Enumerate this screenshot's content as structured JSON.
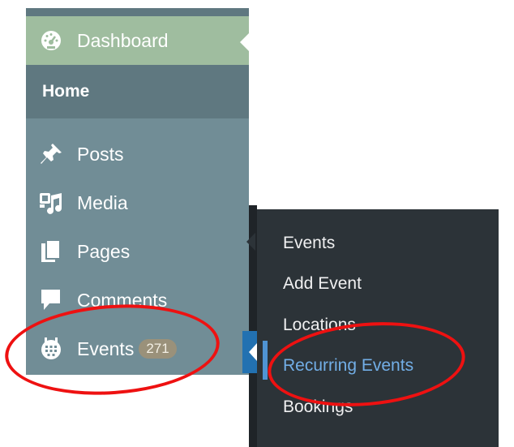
{
  "menu": {
    "dashboard": {
      "label": "Dashboard",
      "icon": "dashboard-gauge-icon"
    },
    "home": {
      "label": "Home"
    },
    "items": [
      {
        "label": "Posts",
        "icon": "pin-icon"
      },
      {
        "label": "Media",
        "icon": "media-icon"
      },
      {
        "label": "Pages",
        "icon": "pages-icon"
      },
      {
        "label": "Comments",
        "icon": "comment-icon"
      },
      {
        "label": "Events",
        "icon": "calendar-icon",
        "badge": "271"
      }
    ]
  },
  "flyout": {
    "items": [
      {
        "label": "Events"
      },
      {
        "label": "Add Event"
      },
      {
        "label": "Locations"
      },
      {
        "label": "Recurring Events",
        "current": true
      },
      {
        "label": "Bookings"
      }
    ]
  },
  "colors": {
    "dashboard_bg": "#9fbd9f",
    "home_bg": "#5f7880",
    "menu_bg": "#718d96",
    "flyout_bg": "#2c3338",
    "current_link": "#72aee6",
    "annotation": "#ee1111"
  }
}
